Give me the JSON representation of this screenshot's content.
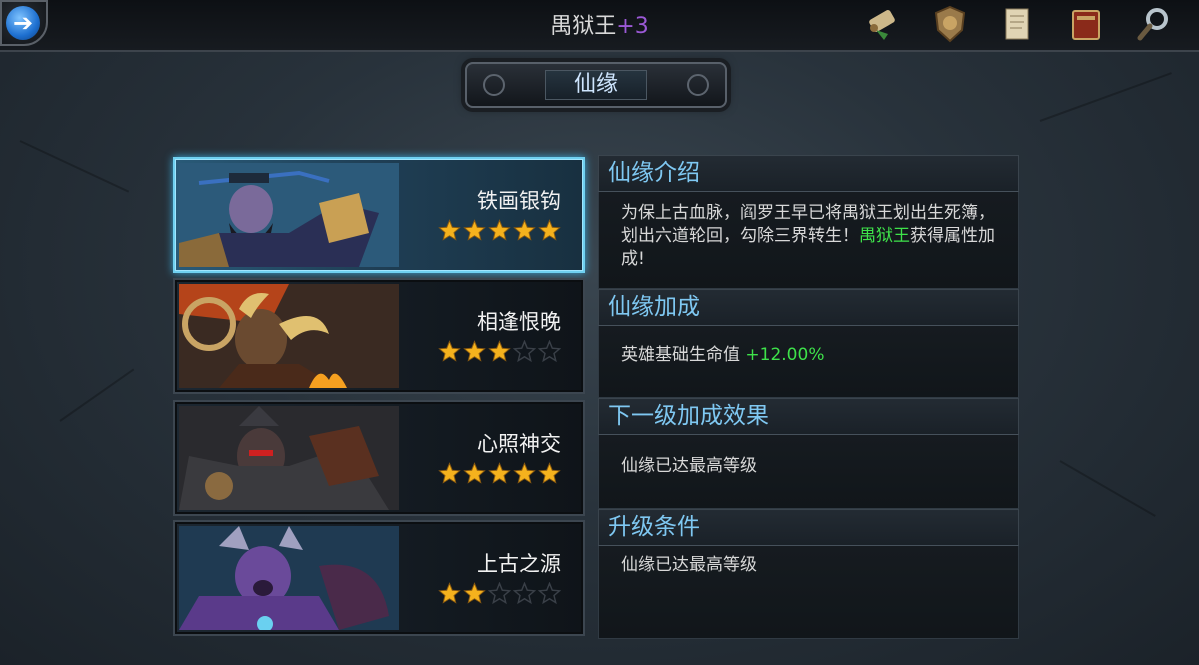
{
  "header": {
    "title": "禺狱王",
    "title_plus": "+3",
    "back_icon": "back-arrow-icon",
    "icons": [
      "scroll-icon",
      "shield-icon",
      "parchment-icon",
      "book-icon",
      "magnifier-icon"
    ]
  },
  "section_title": "仙缘",
  "heroes": [
    {
      "name": "铁画银钩",
      "stars": 5,
      "max_stars": 5,
      "selected": true
    },
    {
      "name": "相逢恨晚",
      "stars": 3,
      "max_stars": 5,
      "selected": false
    },
    {
      "name": "心照神交",
      "stars": 5,
      "max_stars": 5,
      "selected": false
    },
    {
      "name": "上古之源",
      "stars": 2,
      "max_stars": 5,
      "selected": false
    }
  ],
  "info": {
    "intro": {
      "header": "仙缘介绍",
      "text": "为保上古血脉，阎罗王早已将禺狱王划出生死簿，划出六道轮回，勾除三界转生！",
      "highlight": "禺狱王",
      "suffix": "获得属性加成!"
    },
    "bonus": {
      "header": "仙缘加成",
      "label": "英雄基础生命值",
      "value": "+12.00%"
    },
    "next": {
      "header": "下一级加成效果",
      "text": "仙缘已达最高等级"
    },
    "upgrade": {
      "header": "升级条件",
      "text": "仙缘已达最高等级"
    }
  },
  "colors": {
    "accent_blue": "#7fc8f2",
    "highlight_green": "#3ee24a",
    "plus_purple": "#9b59d6",
    "star_gold": "#f5b21d"
  }
}
